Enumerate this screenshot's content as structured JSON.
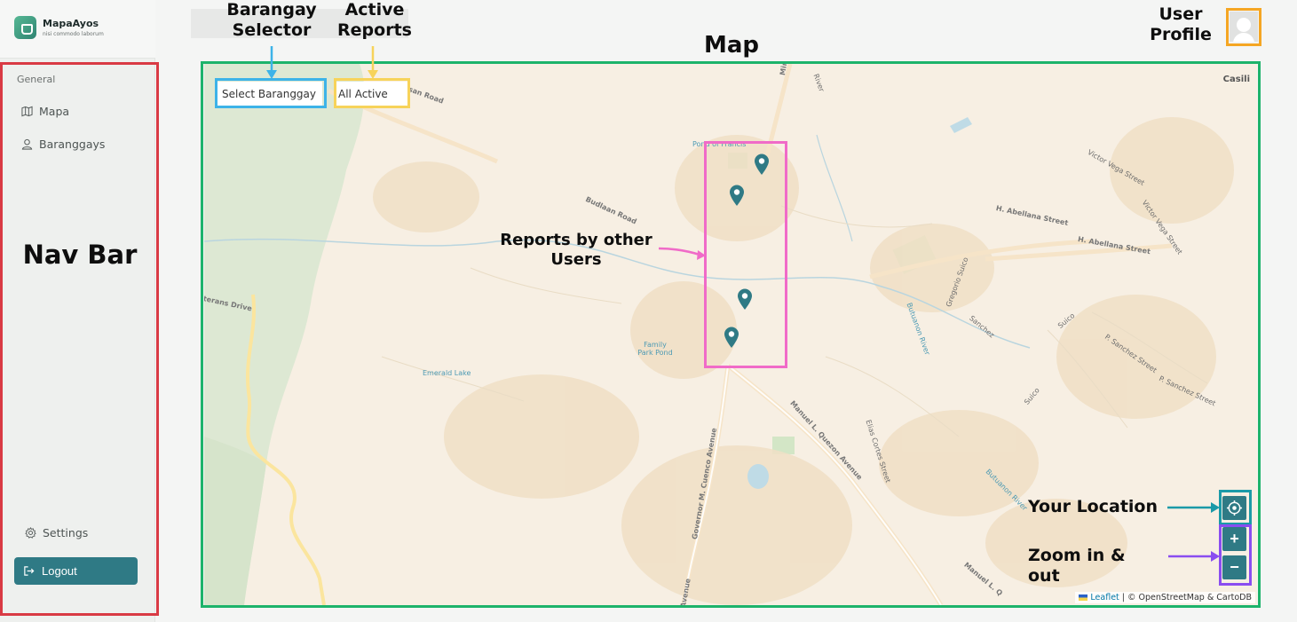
{
  "brand": {
    "name": "MapaAyos",
    "tagline": "nisi commodo laborum"
  },
  "sidebar": {
    "section_label": "General",
    "items": [
      {
        "label": "Mapa",
        "icon": "map-icon"
      },
      {
        "label": "Baranggays",
        "icon": "user-icon"
      }
    ],
    "settings_label": "Settings",
    "logout_label": "Logout"
  },
  "map": {
    "barangay_selector": "Select Baranggay",
    "report_filter": "All Active",
    "corner_label": "Casili",
    "attribution": {
      "leaflet": "Leaflet",
      "rest": "| © OpenStreetMap & CartoDB"
    },
    "zoom_in": "+",
    "zoom_out": "−",
    "markers": 4,
    "place_labels": {
      "mimoza": "Mimoza Street",
      "basan_road": "san Road",
      "pond_francis": "Pond of Francis",
      "budlaan": "Budlaan Road",
      "abellana1": "H. Abellana Street",
      "abellana2": "H. Abellana Street",
      "victor_vega1": "Victor Vega Street",
      "victor_vega2": "Victor Vega Street",
      "gregorio": "Gregorio Suico",
      "sanchez": "Sanchez",
      "suico1": "Suico",
      "suico2": "Suico",
      "psanchez1": "P. Sanchez Street",
      "psanchez2": "P. Sanchez Street",
      "butuanon": "Butuanon River",
      "family_park": "Family Park Pond",
      "emerald": "Emerald Lake",
      "veterans": "terans Drive",
      "quezon": "Manuel L. Quezon Avenue",
      "elias": "Elias Cortes Street",
      "cuenco": "Governor M. Cuenco Avenue",
      "avenue": "Avenue",
      "manuel_l": "Manuel L. Q",
      "butuanon2": "Butuanon River",
      "river_top": "River"
    }
  },
  "annotations": {
    "barangay_selector": "Barangay Selector",
    "active_reports": "Active Reports",
    "map": "Map",
    "user_profile": "User Profile",
    "nav_bar": "Nav Bar",
    "reports_other_users": "Reports by other Users",
    "your_location": "Your Location",
    "zoom": "Zoom in & out",
    "colors": {
      "barangay": "#3db3e8",
      "active": "#f7d35a",
      "map": "#1db36b",
      "profile": "#f5a623",
      "nav": "#d93a44",
      "reports": "#f06bc8",
      "location": "#1b9aa8",
      "zoom": "#8a4df0"
    }
  },
  "theme": {
    "accent": "#2f7a85",
    "marker": "#2f7a85"
  }
}
